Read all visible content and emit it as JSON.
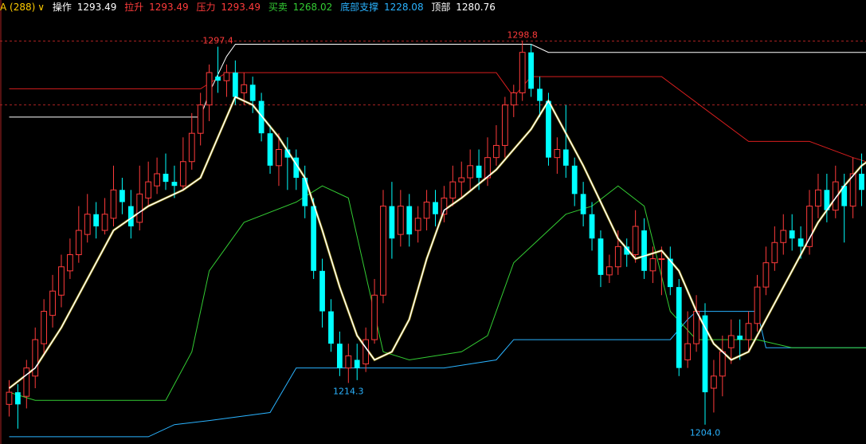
{
  "header": {
    "symbol": "A (288)",
    "dropdown_icon": "chevron-down-icon",
    "items": [
      {
        "label": "操作",
        "value": "1293.49",
        "label_color": "#ffffff",
        "value_color": "#ffffff"
      },
      {
        "label": "拉升",
        "value": "1293.49",
        "label_color": "#ff3b3b",
        "value_color": "#ff3b3b"
      },
      {
        "label": "压力",
        "value": "1293.49",
        "label_color": "#ff3b3b",
        "value_color": "#ff3b3b"
      },
      {
        "label": "买卖",
        "value": "1268.02",
        "label_color": "#33cc33",
        "value_color": "#33cc33"
      },
      {
        "label": "底部支撑",
        "value": "1228.08",
        "label_color": "#2ab3ff",
        "value_color": "#2ab3ff"
      },
      {
        "label": "顶部",
        "value": "1280.76",
        "label_color": "#ffffff",
        "value_color": "#ffffff"
      }
    ],
    "symbol_color": "#ffcc00"
  },
  "colors": {
    "up": "#ff3b3b",
    "down": "#00ffff",
    "pressure": "#d81e1e",
    "support": "#2ab3ff",
    "buysell": "#33cc33",
    "top": "#ffffff",
    "ma": "#ffffff",
    "signal": "#ffe100",
    "grid": "#aa2222"
  },
  "chart_data": {
    "type": "candlestick",
    "ylim": [
      1200,
      1305
    ],
    "ref_lines": [
      1298.8,
      1283.0
    ],
    "high_label": [
      {
        "index": 24,
        "price": 1297.4,
        "text": "1297.4"
      },
      {
        "index": 59,
        "price": 1298.8,
        "text": "1298.8"
      }
    ],
    "low_label": [
      {
        "index": 39,
        "price": 1214.3,
        "text": "1214.3"
      },
      {
        "index": 80,
        "price": 1204.0,
        "text": "1204.0"
      }
    ],
    "candles": [
      [
        1209,
        1212,
        1215,
        1206
      ],
      [
        1212,
        1209,
        1214,
        1203
      ],
      [
        1211,
        1218,
        1220,
        1208
      ],
      [
        1216,
        1225,
        1228,
        1213
      ],
      [
        1224,
        1232,
        1235,
        1221
      ],
      [
        1231,
        1237,
        1241,
        1228
      ],
      [
        1236,
        1243,
        1246,
        1233
      ],
      [
        1242,
        1246,
        1250,
        1240
      ],
      [
        1246,
        1252,
        1258,
        1244
      ],
      [
        1251,
        1256,
        1261,
        1249
      ],
      [
        1256,
        1253,
        1259,
        1250
      ],
      [
        1252,
        1256,
        1260,
        1251
      ],
      [
        1255,
        1262,
        1268,
        1253
      ],
      [
        1262,
        1259,
        1265,
        1256
      ],
      [
        1258,
        1253,
        1262,
        1250
      ],
      [
        1254,
        1261,
        1268,
        1252
      ],
      [
        1260,
        1264,
        1269,
        1258
      ],
      [
        1263,
        1266,
        1270,
        1261
      ],
      [
        1266,
        1264,
        1271,
        1262
      ],
      [
        1264,
        1263,
        1268,
        1260
      ],
      [
        1263,
        1269,
        1275,
        1262
      ],
      [
        1269,
        1276,
        1281,
        1267
      ],
      [
        1276,
        1283,
        1286,
        1273
      ],
      [
        1283,
        1291,
        1293,
        1279
      ],
      [
        1290,
        1289,
        1297.4,
        1286
      ],
      [
        1289,
        1291,
        1293,
        1285
      ],
      [
        1291,
        1285,
        1294,
        1283
      ],
      [
        1286,
        1288,
        1291,
        1283
      ],
      [
        1288,
        1284,
        1290,
        1281
      ],
      [
        1284,
        1276,
        1286,
        1274
      ],
      [
        1276,
        1268,
        1278,
        1266
      ],
      [
        1268,
        1272,
        1276,
        1263
      ],
      [
        1272,
        1270,
        1275,
        1262
      ],
      [
        1270,
        1265,
        1272,
        1262
      ],
      [
        1265,
        1258,
        1268,
        1255
      ],
      [
        1258,
        1242,
        1260,
        1240
      ],
      [
        1242,
        1232,
        1245,
        1228
      ],
      [
        1232,
        1224,
        1235,
        1222
      ],
      [
        1224,
        1218,
        1227,
        1216
      ],
      [
        1218,
        1221,
        1224,
        1214.3
      ],
      [
        1220,
        1218,
        1224,
        1215
      ],
      [
        1219,
        1225,
        1228,
        1217
      ],
      [
        1225,
        1236,
        1240,
        1224
      ],
      [
        1236,
        1258,
        1262,
        1234
      ],
      [
        1258,
        1250,
        1264,
        1245
      ],
      [
        1251,
        1258,
        1262,
        1248
      ],
      [
        1258,
        1251,
        1261,
        1248
      ],
      [
        1252,
        1255,
        1258,
        1249
      ],
      [
        1255,
        1259,
        1262,
        1252
      ],
      [
        1259,
        1256,
        1262,
        1253
      ],
      [
        1256,
        1260,
        1263,
        1254
      ],
      [
        1260,
        1264,
        1268,
        1258
      ],
      [
        1264,
        1265,
        1269,
        1260
      ],
      [
        1265,
        1268,
        1272,
        1262
      ],
      [
        1268,
        1265,
        1272,
        1262
      ],
      [
        1265,
        1270,
        1275,
        1263
      ],
      [
        1270,
        1273,
        1278,
        1268
      ],
      [
        1273,
        1283,
        1285,
        1270
      ],
      [
        1283,
        1286,
        1288,
        1280
      ],
      [
        1286,
        1296,
        1298.8,
        1284
      ],
      [
        1296,
        1287,
        1298,
        1285
      ],
      [
        1287,
        1284,
        1290,
        1280
      ],
      [
        1284,
        1270,
        1286,
        1268
      ],
      [
        1270,
        1272,
        1275,
        1266
      ],
      [
        1272,
        1268,
        1283,
        1265
      ],
      [
        1268,
        1261,
        1270,
        1258
      ],
      [
        1261,
        1256,
        1264,
        1253
      ],
      [
        1256,
        1250,
        1259,
        1247
      ],
      [
        1250,
        1241,
        1252,
        1238
      ],
      [
        1241,
        1243,
        1246,
        1239
      ],
      [
        1243,
        1248,
        1252,
        1241
      ],
      [
        1248,
        1246,
        1250,
        1243
      ],
      [
        1246,
        1253,
        1257,
        1244
      ],
      [
        1252,
        1242,
        1255,
        1240
      ],
      [
        1242,
        1245,
        1248,
        1239
      ],
      [
        1245,
        1245,
        1248,
        1236
      ],
      [
        1245,
        1238,
        1248,
        1236
      ],
      [
        1238,
        1218,
        1240,
        1216
      ],
      [
        1220,
        1224,
        1232,
        1218
      ],
      [
        1224,
        1232,
        1236,
        1222
      ],
      [
        1231,
        1212,
        1234,
        1204
      ],
      [
        1213,
        1216,
        1220,
        1207
      ],
      [
        1216,
        1222,
        1226,
        1211
      ],
      [
        1223,
        1226,
        1230,
        1219
      ],
      [
        1226,
        1225,
        1230,
        1220
      ],
      [
        1225,
        1229,
        1232,
        1222
      ],
      [
        1229,
        1238,
        1241,
        1227
      ],
      [
        1238,
        1244,
        1248,
        1236
      ],
      [
        1244,
        1249,
        1253,
        1242
      ],
      [
        1249,
        1252,
        1256,
        1246
      ],
      [
        1252,
        1250,
        1256,
        1247
      ],
      [
        1250,
        1248,
        1253,
        1245
      ],
      [
        1248,
        1258,
        1262,
        1246
      ],
      [
        1258,
        1262,
        1266,
        1255
      ],
      [
        1262,
        1257,
        1266,
        1254
      ],
      [
        1257,
        1264,
        1268,
        1255
      ],
      [
        1263,
        1258,
        1266,
        1249
      ],
      [
        1258,
        1266,
        1270,
        1255
      ],
      [
        1266,
        1262,
        1271,
        1258
      ]
    ],
    "pressure": [
      [
        0,
        1287
      ],
      [
        5,
        1287
      ],
      [
        15,
        1287
      ],
      [
        22,
        1287
      ],
      [
        25,
        1291
      ],
      [
        56,
        1291
      ],
      [
        58,
        1285
      ],
      [
        60,
        1290
      ],
      [
        62,
        1290
      ],
      [
        75,
        1290
      ],
      [
        85,
        1274
      ],
      [
        92,
        1274
      ],
      [
        97,
        1270
      ],
      [
        100,
        1268
      ]
    ],
    "support": [
      [
        0,
        1201
      ],
      [
        16,
        1201
      ],
      [
        19,
        1204
      ],
      [
        23,
        1205
      ],
      [
        30,
        1207
      ],
      [
        33,
        1218
      ],
      [
        36,
        1218
      ],
      [
        50,
        1218
      ],
      [
        56,
        1220
      ],
      [
        58,
        1225
      ],
      [
        60,
        1225
      ],
      [
        72,
        1225
      ],
      [
        76,
        1225
      ],
      [
        78,
        1230
      ],
      [
        79,
        1232
      ],
      [
        81,
        1232
      ],
      [
        86,
        1232
      ],
      [
        87,
        1223
      ],
      [
        100,
        1223
      ]
    ],
    "buysell": [
      [
        0,
        1212
      ],
      [
        3,
        1210
      ],
      [
        18,
        1210
      ],
      [
        21,
        1222
      ],
      [
        23,
        1242
      ],
      [
        27,
        1254
      ],
      [
        33,
        1259
      ],
      [
        36,
        1263
      ],
      [
        39,
        1260
      ],
      [
        43,
        1222
      ],
      [
        46,
        1220
      ],
      [
        52,
        1222
      ],
      [
        55,
        1226
      ],
      [
        58,
        1244
      ],
      [
        64,
        1256
      ],
      [
        67,
        1258
      ],
      [
        70,
        1263
      ],
      [
        73,
        1258
      ],
      [
        76,
        1232
      ],
      [
        79,
        1225
      ],
      [
        86,
        1225
      ],
      [
        90,
        1223
      ],
      [
        100,
        1223
      ]
    ],
    "top": [
      [
        0,
        1280
      ],
      [
        22,
        1280
      ],
      [
        23,
        1286
      ],
      [
        25,
        1295
      ],
      [
        26,
        1298
      ],
      [
        60,
        1298
      ],
      [
        62,
        1296
      ],
      [
        100,
        1296
      ]
    ],
    "ma": [
      [
        0,
        1213
      ],
      [
        3,
        1218
      ],
      [
        6,
        1228
      ],
      [
        9,
        1240
      ],
      [
        12,
        1252
      ],
      [
        16,
        1258
      ],
      [
        20,
        1262
      ],
      [
        22,
        1265
      ],
      [
        24,
        1275
      ],
      [
        26,
        1285
      ],
      [
        28,
        1283
      ],
      [
        31,
        1275
      ],
      [
        34,
        1265
      ],
      [
        36,
        1252
      ],
      [
        38,
        1238
      ],
      [
        40,
        1226
      ],
      [
        42,
        1220
      ],
      [
        44,
        1222
      ],
      [
        46,
        1230
      ],
      [
        48,
        1245
      ],
      [
        50,
        1257
      ],
      [
        52,
        1260
      ],
      [
        56,
        1267
      ],
      [
        60,
        1277
      ],
      [
        62,
        1284
      ],
      [
        64,
        1276
      ],
      [
        66,
        1268
      ],
      [
        68,
        1259
      ],
      [
        70,
        1250
      ],
      [
        72,
        1245
      ],
      [
        75,
        1247
      ],
      [
        77,
        1242
      ],
      [
        79,
        1232
      ],
      [
        81,
        1224
      ],
      [
        83,
        1220
      ],
      [
        85,
        1222
      ],
      [
        87,
        1230
      ],
      [
        90,
        1242
      ],
      [
        93,
        1254
      ],
      [
        96,
        1263
      ],
      [
        98,
        1268
      ],
      [
        100,
        1271
      ]
    ]
  }
}
